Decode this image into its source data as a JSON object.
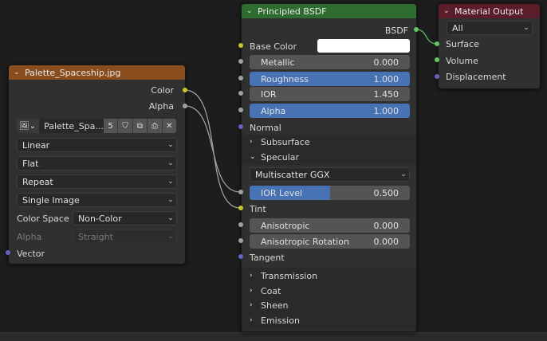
{
  "image_texture_node": {
    "title": "Palette_Spaceship.jpg",
    "header_color": "#8a4e1e",
    "outputs": {
      "color": "Color",
      "alpha": "Alpha"
    },
    "image_name": "Palette_Spa...",
    "user_count": "5",
    "interpolation": "Linear",
    "projection": "Flat",
    "extension": "Repeat",
    "source": "Single Image",
    "color_space_label": "Color Space",
    "color_space_value": "Non-Color",
    "alpha_label": "Alpha",
    "alpha_value": "Straight",
    "vector_input": "Vector"
  },
  "principled_node": {
    "title": "Principled BSDF",
    "header_color": "#2f6c30",
    "output": "BSDF",
    "base_color_label": "Base Color",
    "base_color_value": "#ffffff",
    "metallic": {
      "label": "Metallic",
      "value": "0.000",
      "fraction": 0
    },
    "roughness": {
      "label": "Roughness",
      "value": "1.000",
      "fraction": 1
    },
    "ior": {
      "label": "IOR",
      "value": "1.450"
    },
    "alpha": {
      "label": "Alpha",
      "value": "1.000",
      "fraction": 1
    },
    "normal": "Normal",
    "subsurface": "Subsurface",
    "specular": "Specular",
    "distribution": "Multiscatter GGX",
    "ior_level": {
      "label": "IOR Level",
      "value": "0.500",
      "fraction": 0.5
    },
    "tint": "Tint",
    "anisotropic": {
      "label": "Anisotropic",
      "value": "0.000"
    },
    "anisotropic_rotation": {
      "label": "Anisotropic Rotation",
      "value": "0.000"
    },
    "tangent": "Tangent",
    "transmission": "Transmission",
    "coat": "Coat",
    "sheen": "Sheen",
    "emission": "Emission"
  },
  "material_output_node": {
    "title": "Material Output",
    "header_color": "#5c1d2b",
    "target": "All",
    "surface": "Surface",
    "volume": "Volume",
    "displacement": "Displacement"
  },
  "icons": {
    "collapse": "chevron-down-icon",
    "expand": "chevron-right-icon",
    "image": "image-icon",
    "fake_user": "shield-icon",
    "duplicate": "duplicate-icon",
    "pack": "pack-icon",
    "unlink": "close-icon"
  }
}
